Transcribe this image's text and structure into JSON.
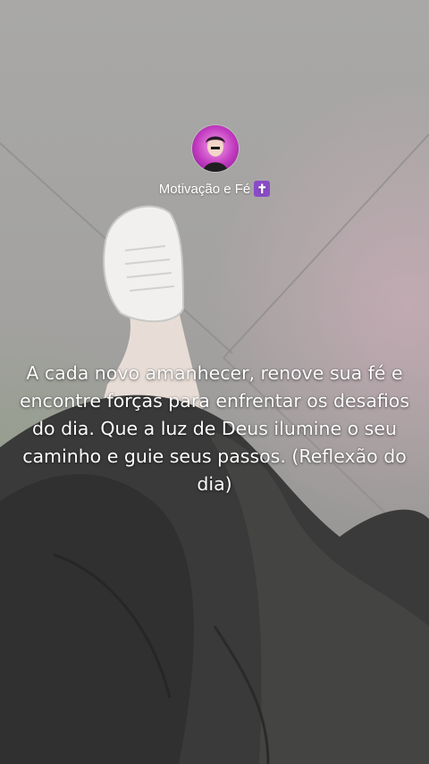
{
  "profile": {
    "name": "Motivação e Fé",
    "badge_icon": "latin-cross-icon",
    "badge_color": "#8a4bc7",
    "avatar_icon": "profile-avatar"
  },
  "caption": {
    "text": "A cada novo amanhecer, renove sua fé e encontre forças para enfrentar os desafios do dia. Que a luz de Deus ilumine o seu caminho e guie seus passos. (Reflexão do dia)"
  },
  "colors": {
    "text": "#ffffff",
    "avatar_ring": "#c23ac0"
  }
}
